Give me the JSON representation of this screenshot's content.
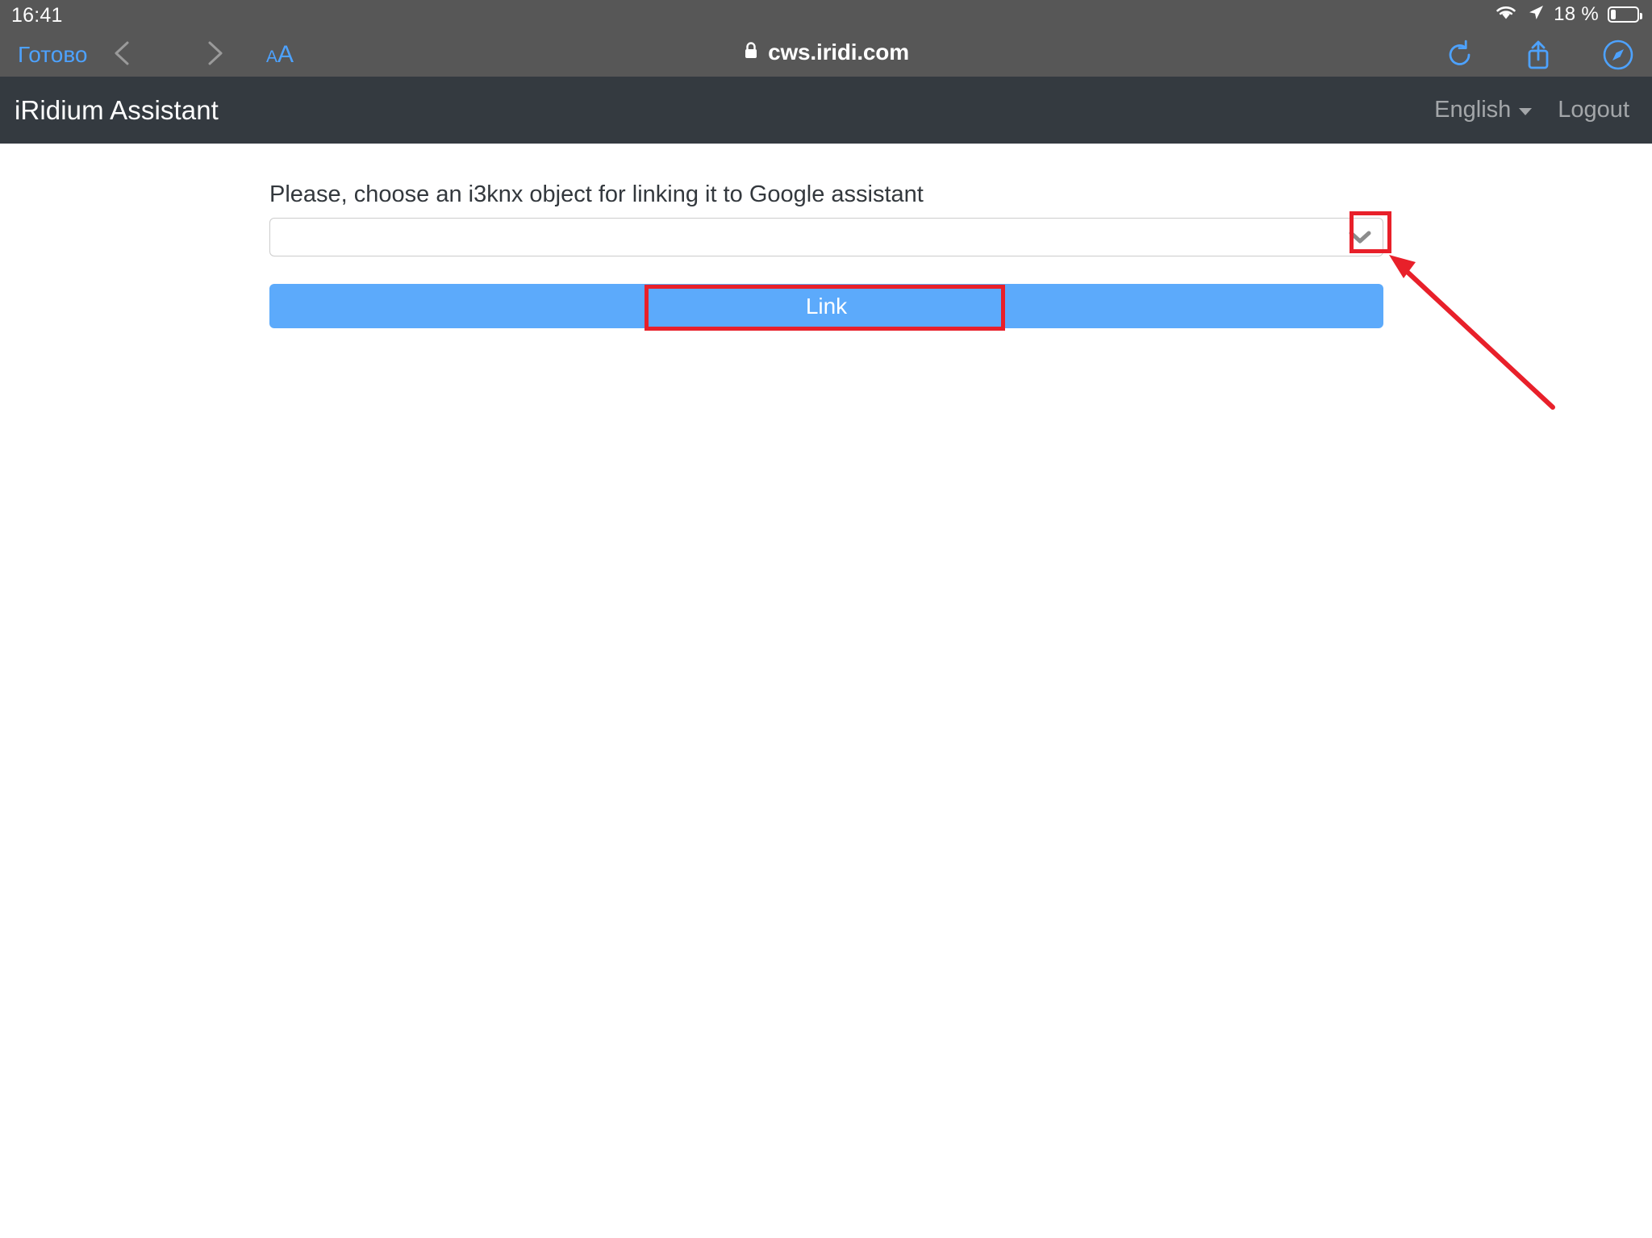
{
  "device": {
    "status_bar": {
      "clock": "16:41",
      "battery_percent": "18 %",
      "wifi_icon": "wifi-icon",
      "location_icon": "location-arrow-icon",
      "battery_icon": "battery-icon"
    }
  },
  "browser": {
    "done_label": "Готово",
    "back_icon": "chevron-left-icon",
    "forward_icon": "chevron-right-icon",
    "text_size_small": "A",
    "text_size_large": "A",
    "lock_icon": "lock-icon",
    "url": "cws.iridi.com",
    "reload_icon": "reload-icon",
    "share_icon": "share-icon",
    "compass_icon": "safari-compass-icon"
  },
  "navbar": {
    "brand": "iRidium Assistant",
    "language": "English",
    "language_caret_icon": "chevron-down-icon",
    "logout": "Logout",
    "background_color": "#343a40"
  },
  "main": {
    "prompt": "Please, choose an i3knx object for linking it to Google assistant",
    "select": {
      "value": "",
      "placeholder": "",
      "chevron_icon": "chevron-down-icon"
    },
    "link_button": {
      "label": "Link",
      "color": "#5caafb"
    }
  },
  "annotations": {
    "highlight_color": "#e8202a",
    "chevron_highlight": "select-dropdown-arrow",
    "link_highlight": "link-button",
    "arrow_icon": "pointer-arrow"
  }
}
